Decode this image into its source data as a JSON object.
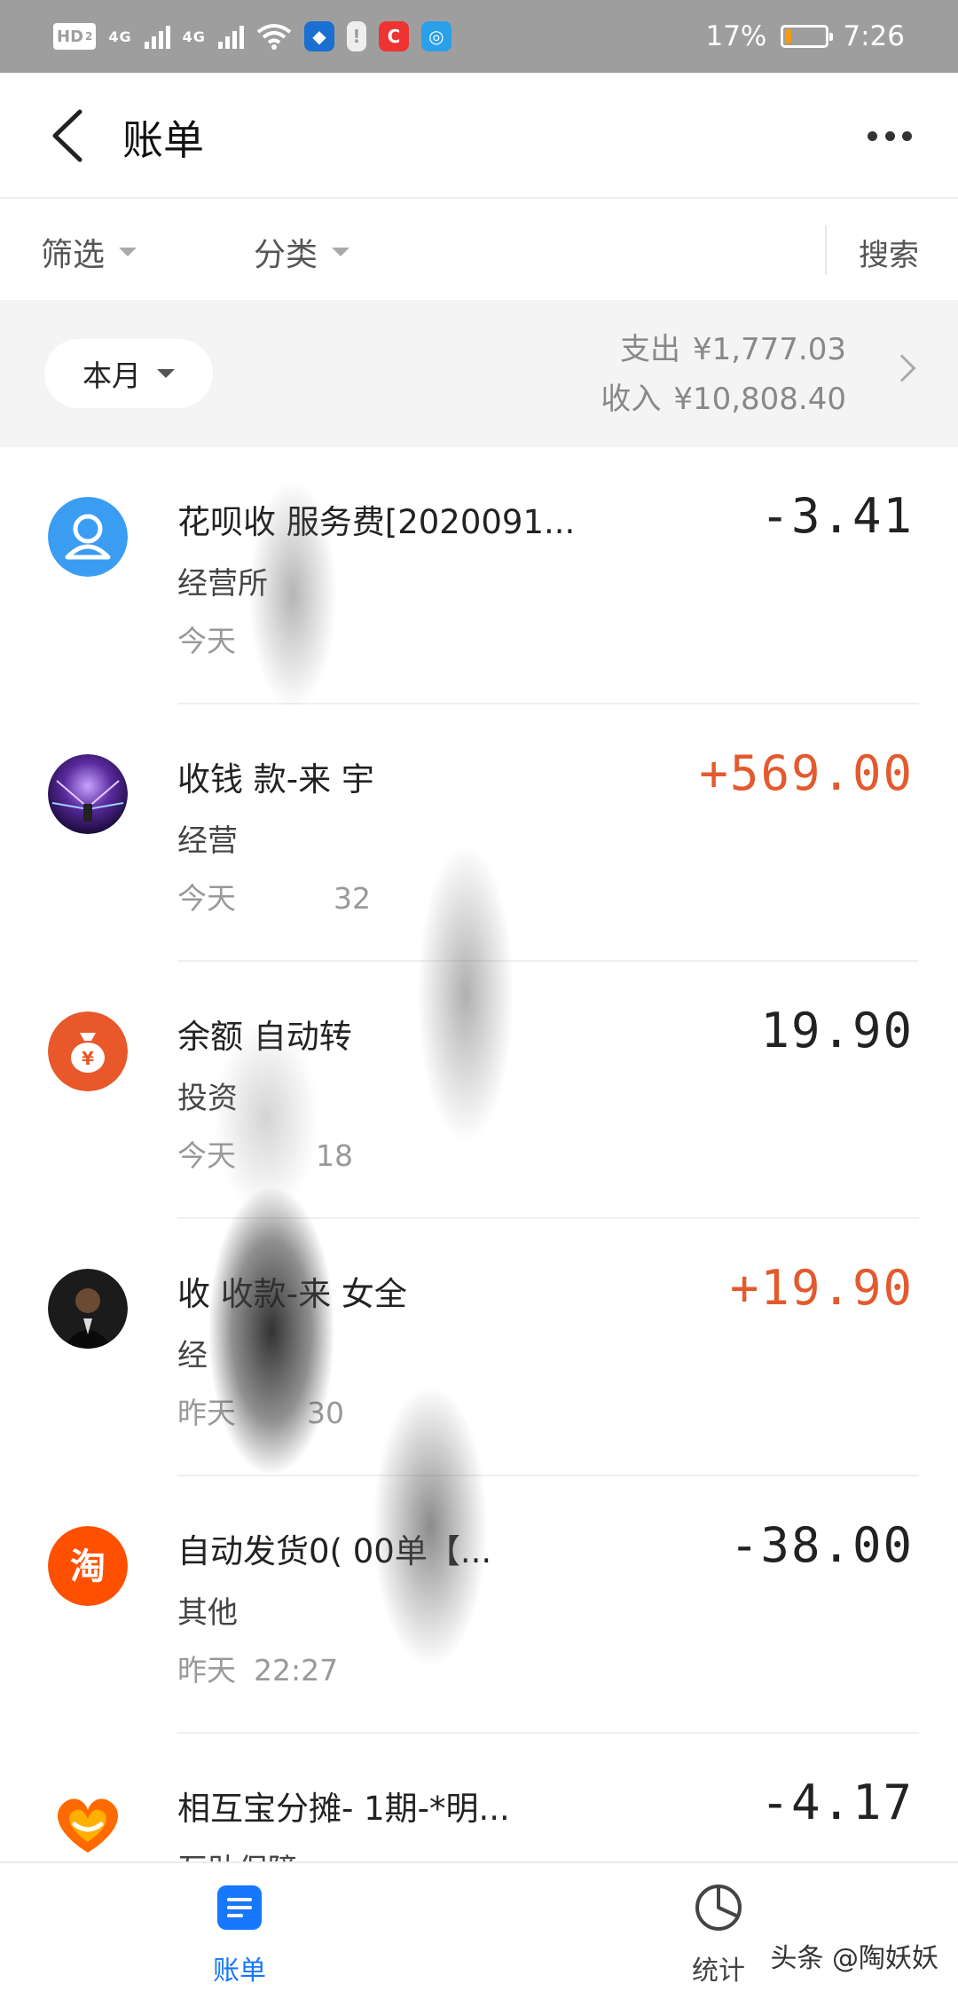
{
  "status_bar": {
    "hd": "HD",
    "hd_sub": "2",
    "sim1": "4G",
    "sim2": "4G",
    "battery_percent": "17%",
    "battery_level": 0.17,
    "time": "7:26"
  },
  "header": {
    "title": "账单"
  },
  "filters": {
    "filter_label": "筛选",
    "category_label": "分类",
    "search_label": "搜索"
  },
  "summary": {
    "period": "本月",
    "expense_label": "支出",
    "expense_value": "¥1,777.03",
    "income_label": "收入",
    "income_value": "¥10,808.40"
  },
  "transactions": [
    {
      "title": "花呗收   服务费[2020091...",
      "category": "经营所",
      "date": "今天",
      "time": "",
      "amount": "-3.41",
      "type": "expense",
      "icon": "user-avatar-icon"
    },
    {
      "title": "收钱     款-来      宇",
      "category": "经营",
      "date": "今天",
      "time": "32",
      "amount": "+569.00",
      "type": "income",
      "icon": "photo-avatar"
    },
    {
      "title": "余额    自动转",
      "category": "投资",
      "date": "今天",
      "time": "18",
      "amount": "19.90",
      "type": "neutral",
      "icon": "money-bag-icon"
    },
    {
      "title": "收     收款-来      女全",
      "category": "经",
      "date": "昨天",
      "time": "30",
      "amount": "+19.90",
      "type": "income",
      "icon": "photo-avatar"
    },
    {
      "title": "自动发货0(      00单【...",
      "category": "其他",
      "date": "昨天",
      "time": "22:27",
      "amount": "-38.00",
      "type": "expense",
      "icon": "taobao-icon"
    },
    {
      "title": "相互宝分摊-       1期-*明...",
      "category": "互助保障",
      "date": "",
      "time": "",
      "amount": "-4.17",
      "type": "expense",
      "icon": "xianghubao-icon"
    }
  ],
  "tabs": [
    {
      "label": "账单",
      "icon": "bill-list-icon",
      "active": true
    },
    {
      "label": "统计",
      "icon": "pie-chart-icon",
      "active": false
    }
  ],
  "watermark": "头条 @陶妖妖",
  "colors": {
    "income": "#e35a2e",
    "accent": "#1677ff",
    "status_bar": "#9e9e9e",
    "summary_bg": "#f4f4f4"
  }
}
